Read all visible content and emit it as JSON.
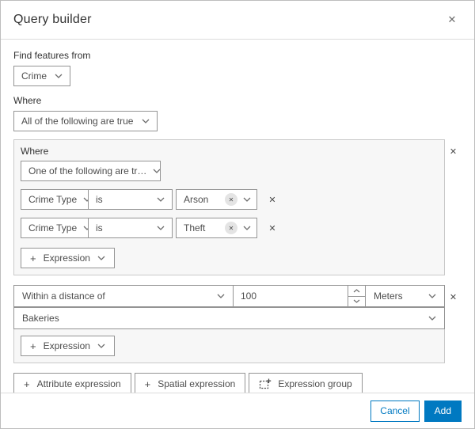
{
  "dialog": {
    "title": "Query builder",
    "find_features_label": "Find features from",
    "layer_select": {
      "value": "Crime"
    },
    "where_label": "Where",
    "match_select": {
      "value": "All of the following are true"
    },
    "group1": {
      "where_label": "Where",
      "match_select": {
        "value": "One of the following are tr…"
      },
      "rows": [
        {
          "field": "Crime Type",
          "operator": "is",
          "value": "Arson"
        },
        {
          "field": "Crime Type",
          "operator": "is",
          "value": "Theft"
        }
      ],
      "add_expression_label": "Expression"
    },
    "group2": {
      "spatial_select": {
        "value": "Within a distance of"
      },
      "distance_value": "100",
      "unit_select": {
        "value": "Meters"
      },
      "layer_select": {
        "value": "Bakeries"
      },
      "add_expression_label": "Expression"
    },
    "footer_buttons": {
      "attribute_expression": "Attribute expression",
      "spatial_expression": "Spatial expression",
      "expression_group": "Expression group",
      "cancel": "Cancel",
      "add": "Add"
    },
    "icons": {
      "close": "✕",
      "remove": "✕",
      "clear": "✕",
      "plus": "+"
    },
    "colors": {
      "accent": "#0079c1",
      "group_background": "#f7f7f7",
      "control_border": "#949494"
    }
  }
}
